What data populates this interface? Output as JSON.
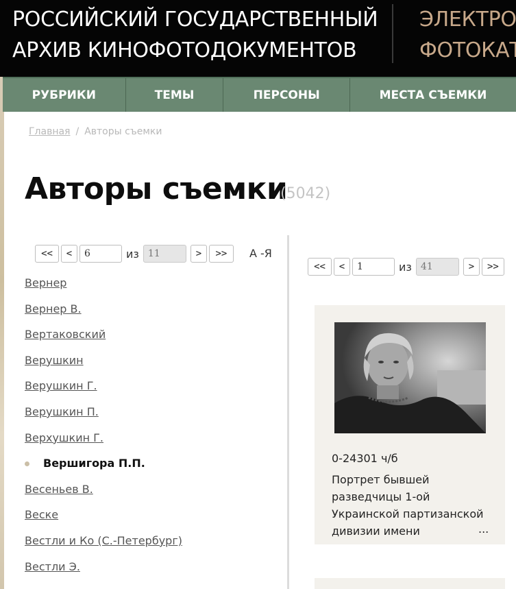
{
  "header": {
    "title_line1": "РОССИЙСКИЙ ГОСУДАРСТВЕННЫЙ",
    "title_line2": "АРХИВ КИНОФОТОДОКУМЕНТОВ",
    "right_line1": "ЭЛЕКТРОН",
    "right_line2": "ФОТОКАТА"
  },
  "nav": [
    {
      "label": "РУБРИКИ"
    },
    {
      "label": "ТЕМЫ"
    },
    {
      "label": "ПЕРСОНЫ"
    },
    {
      "label": "МЕСТА СЪЕМКИ"
    }
  ],
  "breadcrumb": {
    "home": "Главная",
    "separator": "/",
    "current": "Авторы съемки"
  },
  "page": {
    "title": "Авторы съемки",
    "count": "(5042)"
  },
  "authors_pager": {
    "first": "<<",
    "prev": "<",
    "current": "6",
    "of": "из",
    "total": "11",
    "next": ">",
    "last": ">>",
    "sort_label": "А -Я"
  },
  "authors": [
    {
      "name": "Вернер"
    },
    {
      "name": "Вернер В."
    },
    {
      "name": "Вертаковский"
    },
    {
      "name": "Верушкин"
    },
    {
      "name": "Верушкин Г."
    },
    {
      "name": "Верушкин П."
    },
    {
      "name": "Верхушкин Г."
    },
    {
      "name": "Вершигора П.П."
    },
    {
      "name": "Весеньев В."
    },
    {
      "name": "Веске"
    },
    {
      "name": "Вестли и Ко (С.-Петербург)"
    },
    {
      "name": "Вестли Э."
    }
  ],
  "active_author_index": 7,
  "photos_pager": {
    "first": "<<",
    "prev": "<",
    "current": "1",
    "of": "из",
    "total": "41",
    "next": ">",
    "last": ">>"
  },
  "photo_card": {
    "code": "0-24301 ч/б",
    "description": "Портрет бывшей разведчицы 1-ой Украинской партизанской дивизии имени",
    "more": "..."
  },
  "colors": {
    "header_bg": "#050505",
    "nav_bg": "#6a8872",
    "accent_header_right": "#c7a88a",
    "card_bg": "#f3f1ec"
  }
}
